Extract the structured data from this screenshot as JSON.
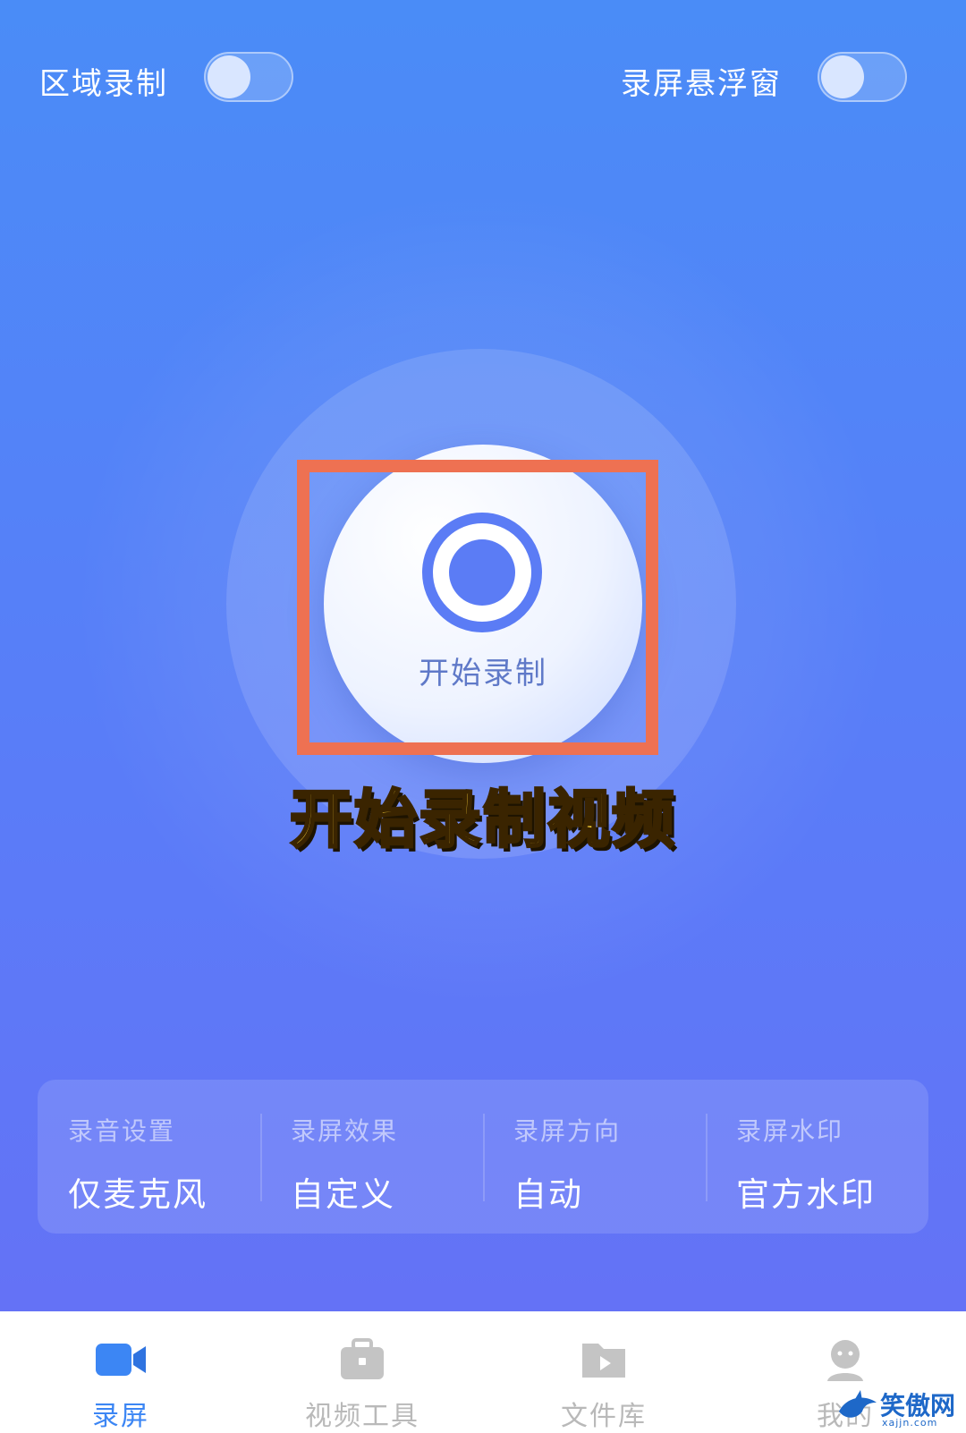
{
  "top_toggles": {
    "area_record": {
      "label": "区域录制",
      "on": false
    },
    "floating_window": {
      "label": "录屏悬浮窗",
      "on": false
    }
  },
  "record_button": {
    "label": "开始录制"
  },
  "caption": "开始录制视频",
  "settings": [
    {
      "title": "录音设置",
      "value": "仅麦克风"
    },
    {
      "title": "录屏效果",
      "value": "自定义"
    },
    {
      "title": "录屏方向",
      "value": "自动"
    },
    {
      "title": "录屏水印",
      "value": "官方水印"
    }
  ],
  "tabs": [
    {
      "label": "录屏",
      "icon": "video-camera-icon",
      "active": true
    },
    {
      "label": "视频工具",
      "icon": "toolbox-icon",
      "active": false
    },
    {
      "label": "文件库",
      "icon": "folder-play-icon",
      "active": false
    },
    {
      "label": "我的",
      "icon": "user-icon",
      "active": false
    }
  ],
  "watermark": {
    "text": "笑傲网",
    "sub": "xajjn.com"
  },
  "colors": {
    "accent": "#3c86f4",
    "background_top": "#4a8cf7",
    "background_bottom": "#6472f6",
    "highlight": "#ee7152",
    "caption": "#ffd63a"
  }
}
